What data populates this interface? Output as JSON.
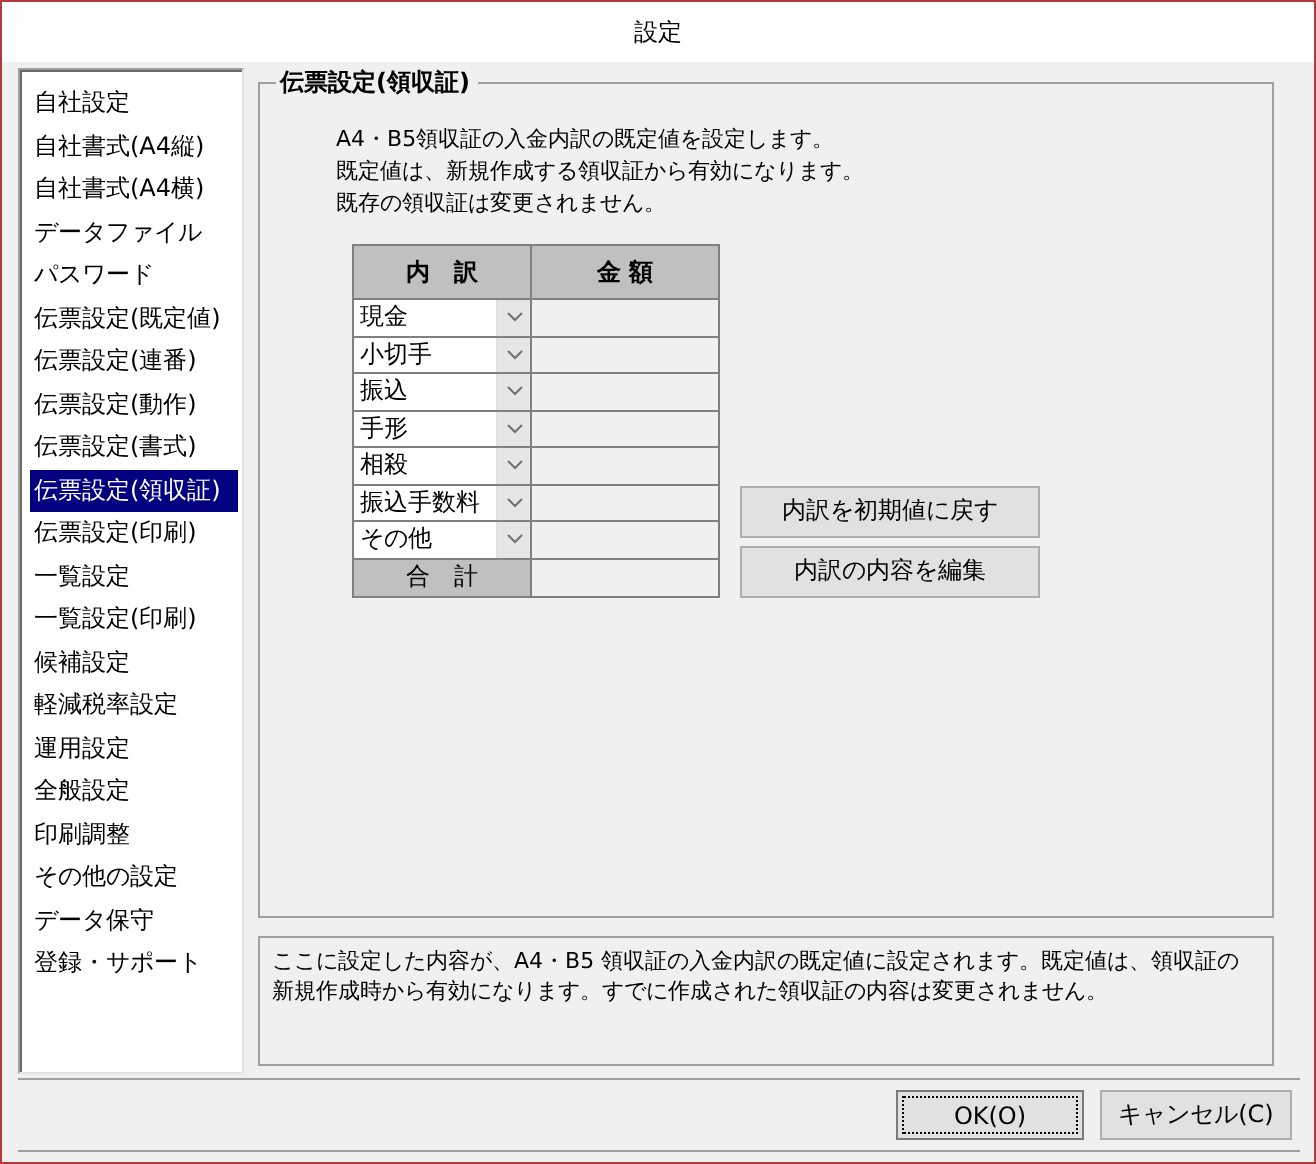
{
  "window": {
    "title": "設定"
  },
  "sidebar": {
    "items": [
      {
        "label": "自社設定",
        "selected": false
      },
      {
        "label": "自社書式(A4縦)",
        "selected": false
      },
      {
        "label": "自社書式(A4横)",
        "selected": false
      },
      {
        "label": "データファイル",
        "selected": false
      },
      {
        "label": "パスワード",
        "selected": false
      },
      {
        "label": "伝票設定(既定値)",
        "selected": false
      },
      {
        "label": "伝票設定(連番)",
        "selected": false
      },
      {
        "label": "伝票設定(動作)",
        "selected": false
      },
      {
        "label": "伝票設定(書式)",
        "selected": false
      },
      {
        "label": "伝票設定(領収証)",
        "selected": true
      },
      {
        "label": "伝票設定(印刷)",
        "selected": false
      },
      {
        "label": "一覧設定",
        "selected": false
      },
      {
        "label": "一覧設定(印刷)",
        "selected": false
      },
      {
        "label": "候補設定",
        "selected": false
      },
      {
        "label": "軽減税率設定",
        "selected": false
      },
      {
        "label": "運用設定",
        "selected": false
      },
      {
        "label": "全般設定",
        "selected": false
      },
      {
        "label": "印刷調整",
        "selected": false
      },
      {
        "label": "その他の設定",
        "selected": false
      },
      {
        "label": "データ保守",
        "selected": false
      },
      {
        "label": "登録・サポート",
        "selected": false
      }
    ]
  },
  "group": {
    "title": "伝票設定(領収証)",
    "description": [
      "A4・B5領収証の入金内訳の既定値を設定します。",
      "既定値は、新規作成する領収証から有効になります。",
      "既存の領収証は変更されません。"
    ],
    "table": {
      "columns": [
        "内　訳",
        "金 額"
      ],
      "rows": [
        {
          "item": "現金"
        },
        {
          "item": "小切手"
        },
        {
          "item": "振込"
        },
        {
          "item": "手形"
        },
        {
          "item": "相殺"
        },
        {
          "item": "振込手数料"
        },
        {
          "item": "その他"
        }
      ],
      "total_label": "合　計"
    },
    "buttons": [
      "内訳を初期値に戻す",
      "内訳の内容を編集"
    ]
  },
  "note": "ここに設定した内容が、A4・B5 領収証の入金内訳の既定値に設定されます。既定値は、領収証の新規作成時から有効になります。すでに作成された領収証の内容は変更されません。",
  "dialog_buttons": [
    {
      "label": "OK(O)",
      "default": true
    },
    {
      "label": "キャンセル(C)",
      "default": false
    }
  ]
}
